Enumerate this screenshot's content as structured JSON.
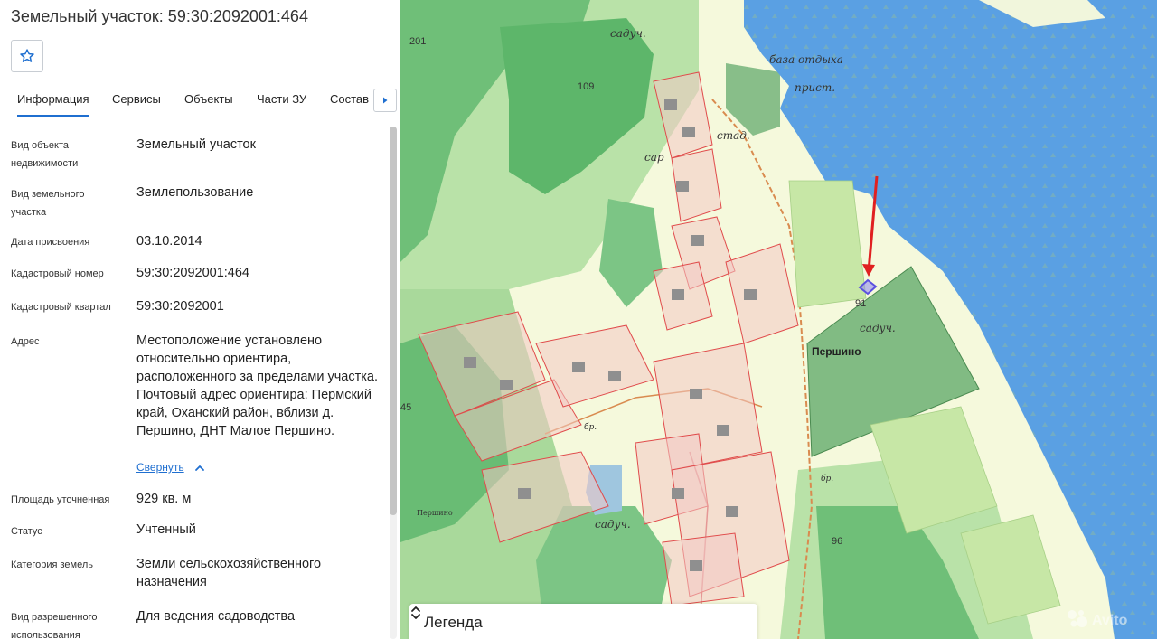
{
  "title": "Земельный участок: 59:30:2092001:464",
  "tabs": [
    {
      "label": "Информация"
    },
    {
      "label": "Сервисы"
    },
    {
      "label": "Объекты"
    },
    {
      "label": "Части ЗУ"
    },
    {
      "label": "Состав"
    }
  ],
  "info": {
    "object_type_label": "Вид объекта недвижимости",
    "object_type_value": "Земельный участок",
    "plot_type_label": "Вид земельного участка",
    "plot_type_value": "Землепользование",
    "assigned_date_label": "Дата присвоения",
    "assigned_date_value": "03.10.2014",
    "cadastral_number_label": "Кадастровый номер",
    "cadastral_number_value": "59:30:2092001:464",
    "cadastral_block_label": "Кадастровый квартал",
    "cadastral_block_value": "59:30:2092001",
    "address_label": "Адрес",
    "address_value": "Местоположение установлено относительно ориентира, расположенного за пределами участка. Почтовый адрес ориентира: Пермский край, Оханский район, вблизи д. Першино, ДНТ Малое Першино.",
    "collapse_label": "Свернуть",
    "area_label": "Площадь уточненная",
    "area_value": "929 кв. м",
    "status_label": "Статус",
    "status_value": "Учтенный",
    "land_category_label": "Категория земель",
    "land_category_value": "Земли сельскохозяйственного назначения",
    "permitted_use_label": "Вид разрешенного использования",
    "permitted_use_value": "Для ведения садоводства"
  },
  "map": {
    "labels": {
      "garden_top": "садуч.",
      "recreation_base": "база отдыха",
      "pier": "прист.",
      "stadium": "стад.",
      "sar": "сар",
      "garden_right": "садуч.",
      "village": "Першино",
      "garden_bottom": "садуч.",
      "ford_1": "бр.",
      "ford_2": "бр.",
      "village_small": "Першино"
    },
    "numbers": {
      "n201": "201",
      "n109": "109",
      "n91": "91",
      "n45": "45",
      "n96": "96"
    },
    "legend_label": "Легенда",
    "watermark": "Avito",
    "colors": {
      "water": "#5aa0e3",
      "forest_dark": "#74c17d",
      "forest_light": "#b8e2a4",
      "plot_border": "#e04b4b",
      "highlight_plot": "#6a5ae0",
      "arrow": "#e02020"
    }
  },
  "icons": {
    "favorite": "star-outline-icon",
    "tab_next": "caret-right-icon",
    "collapse": "chevron-up-icon",
    "legend": "chevron-up-down-icon"
  }
}
